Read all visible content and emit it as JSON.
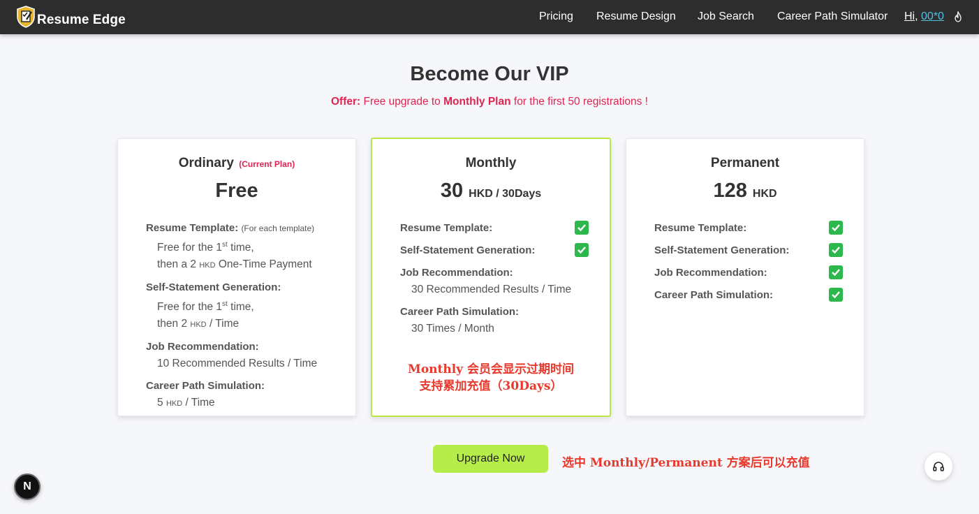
{
  "nav": {
    "brand": "Resume Edge",
    "links": [
      "Pricing",
      "Resume Design",
      "Job Search",
      "Career Path Simulator"
    ],
    "greeting": "Hi,",
    "username": "00*0"
  },
  "header": {
    "title": "Become Our VIP",
    "offer_prefix": "Offer:",
    "offer_text1": " Free upgrade to ",
    "offer_plan": "Monthly Plan",
    "offer_text2": " for the first 50 registrations !"
  },
  "plans": {
    "ordinary": {
      "name": "Ordinary",
      "current_tag": "(Current Plan)",
      "price": "Free",
      "f1_label": "Resume Template:",
      "f1_note": "(For each template)",
      "f1_d1a": "Free for the 1",
      "f1_d1sup": "st",
      "f1_d1b": " time,",
      "f1_d2a": "then a 2 ",
      "f1_d2unit": "HKD",
      "f1_d2b": " One-Time Payment",
      "f2_label": "Self-Statement Generation:",
      "f2_d1a": "Free for the 1",
      "f2_d1sup": "st",
      "f2_d1b": " time,",
      "f2_d2a": "then 2 ",
      "f2_d2unit": "HKD",
      "f2_d2b": " / Time",
      "f3_label": "Job Recommendation:",
      "f3_d1": "10 Recommended Results / Time",
      "f4_label": "Career Path Simulation:",
      "f4_d1a": "5 ",
      "f4_d1unit": "HKD",
      "f4_d1b": " / Time"
    },
    "monthly": {
      "name": "Monthly",
      "price": "30",
      "price_unit": "HKD / 30Days",
      "f1_label": "Resume Template:",
      "f2_label": "Self-Statement Generation:",
      "f3_label": "Job Recommendation:",
      "f3_d1": "30 Recommended Results / Time",
      "f4_label": "Career Path Simulation:",
      "f4_d1": "30 Times / Month",
      "annotation_line1": "Monthly 会员会显示过期时间",
      "annotation_line2": "支持累加充值（30Days）"
    },
    "permanent": {
      "name": "Permanent",
      "price": "128",
      "price_unit": "HKD",
      "f1_label": "Resume Template:",
      "f2_label": "Self-Statement Generation:",
      "f3_label": "Job Recommendation:",
      "f4_label": "Career Path Simulation:"
    }
  },
  "actions": {
    "upgrade_label": "Upgrade Now",
    "annotation": "选中 Monthly/Permanent 方案后可以充值"
  },
  "floating": {
    "n_badge": "N"
  },
  "colors": {
    "accent_green": "#b7ed4a",
    "offer_red": "#e0244f",
    "annotation_red": "#e8392d",
    "check_green": "#2db84d",
    "link_blue": "#4fc1e9"
  }
}
